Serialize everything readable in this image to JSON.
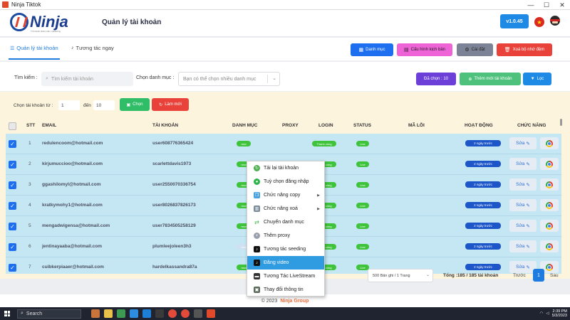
{
  "window": {
    "title": "Ninja Tiktok",
    "controls": [
      "—",
      "☐",
      "✕"
    ]
  },
  "header": {
    "logo_text": "Ninja",
    "logo_tagline": "Trở thành phần mềm marketing",
    "page_title": "Quản lý tài khoản",
    "version": "v1.0.45",
    "flag_symbol": "★"
  },
  "tabs": [
    {
      "label": "Quản lý tài khoản",
      "icon": "list-icon",
      "active": true
    },
    {
      "label": "Tương tác ngay",
      "icon": "tiktok-icon",
      "active": false
    }
  ],
  "toolbar": {
    "category": "Danh mục",
    "script_config": "Cấu hình kịch bản",
    "settings": "Cài đặt",
    "clear_cache": "Xoá bộ nhớ đệm",
    "colors": {
      "category": "#1e6ff0",
      "script_config": "#ee63d6",
      "settings": "#7d8396",
      "clear_cache": "#e8423a"
    }
  },
  "search": {
    "label": "Tìm kiếm :",
    "placeholder": "Tìm kiếm tài khoản",
    "category_label": "Chọn danh mục :",
    "category_placeholder": "Bạn có thể chọn nhiều danh mục",
    "selected_button": "Đã chọn : 10",
    "add_account_button": "Thêm mới tài khoản",
    "filter_button": "Lọc"
  },
  "range": {
    "label": "Chọn tài khoản từ :",
    "from": "1",
    "to_label": "đến",
    "to": "10",
    "select_button": "Chọn",
    "reset_button": "Làm mới"
  },
  "table": {
    "columns": {
      "stt": "STT",
      "email": "EMAIL",
      "account": "TÀI KHOẢN",
      "category": "DANH MỤC",
      "proxy": "PROXY",
      "login": "LOGIN",
      "status": "STATUS",
      "error": "MÃ LỖI",
      "activity": "HOẠT ĐỘNG",
      "actions": "CHỨC NĂNG"
    },
    "rows": [
      {
        "stt": "1",
        "email": "redulencoom@hotmail.com",
        "account": "user608776365424",
        "category": "new",
        "login": "Thành công",
        "status": "Live",
        "activity": "2 ngày trước",
        "edit": "Sửa"
      },
      {
        "stt": "2",
        "email": "kirjumuccioo@hotmail.com",
        "account": "scarlettdavis1973",
        "category": "new",
        "login": "Thành công",
        "status": "Live",
        "activity": "2 ngày trước",
        "edit": "Sửa"
      },
      {
        "stt": "3",
        "email": "ggashilomyl@hotmail.com",
        "account": "user2550070336754",
        "category": "new",
        "login": "Thành công",
        "status": "Live",
        "activity": "2 ngày trước",
        "edit": "Sửa"
      },
      {
        "stt": "4",
        "email": "kratkymohy1@hotmail.com",
        "account": "user8026837826173",
        "category": "new",
        "login": "Thành công",
        "status": "Live",
        "activity": "2 ngày trước",
        "edit": "Sửa"
      },
      {
        "stt": "5",
        "email": "mengadwigensa@hotmail.com",
        "account": "user7834505258129",
        "category": "new",
        "login": "Thành công",
        "status": "Live",
        "activity": "2 ngày trước",
        "edit": "Sửa"
      },
      {
        "stt": "6",
        "email": "jentinayaaba@hotmail.com",
        "account": "plumleejoleen3h3",
        "category": "new",
        "login": "Thành công",
        "status": "Live",
        "activity": "2 ngày trước",
        "edit": "Sửa"
      },
      {
        "stt": "7",
        "email": "cuibkerpiaaer@hotmail.com",
        "account": "hardelkassandra87a",
        "category": "new",
        "login": "Thành công",
        "status": "Live",
        "activity": "2 ngày trước",
        "edit": "Sửa"
      }
    ]
  },
  "pagination": {
    "per_page": "500 Bản ghi / 1 Trang",
    "total": "Tổng :185 / 185 tài khoản",
    "prev": "Trước",
    "current": "1",
    "next": "Sau"
  },
  "context_menu": [
    {
      "label": "Tải lại tài khoản",
      "icon": "reload-icon",
      "color": "#4caf50",
      "submenu": false
    },
    {
      "label": "Tuỳ chọn đăng nhập",
      "icon": "login-icon",
      "color": "#2db34a",
      "submenu": false
    },
    {
      "label": "Chức năng copy",
      "icon": "copy-icon",
      "color": "#4aa3df",
      "submenu": true
    },
    {
      "label": "Chức năng xoá",
      "icon": "trash-icon",
      "color": "#7a8c99",
      "submenu": true
    },
    {
      "label": "Chuyển danh mục",
      "icon": "swap-icon",
      "color": "#3db54a",
      "submenu": false
    },
    {
      "label": "Thêm proxy",
      "icon": "plus-circle-icon",
      "color": "#9aa0ab",
      "submenu": false
    },
    {
      "label": "Tương tác seeding",
      "icon": "tiktok-icon",
      "color": "#111111",
      "submenu": false
    },
    {
      "label": "Đăng video",
      "icon": "video-icon",
      "color": "#111111",
      "submenu": false,
      "highlighted": true
    },
    {
      "label": "Tương Tác LiveStream",
      "icon": "livestream-icon",
      "color": "#333333",
      "submenu": false
    },
    {
      "label": "Thay đổi thông tin",
      "icon": "profile-icon",
      "color": "#5a6a5a",
      "submenu": false
    }
  ],
  "footer": {
    "copyright": "© 2023",
    "brand": "Ninja Group"
  },
  "taskbar": {
    "search": "Search",
    "time": "2:39 PM",
    "date": "5/3/2023"
  }
}
